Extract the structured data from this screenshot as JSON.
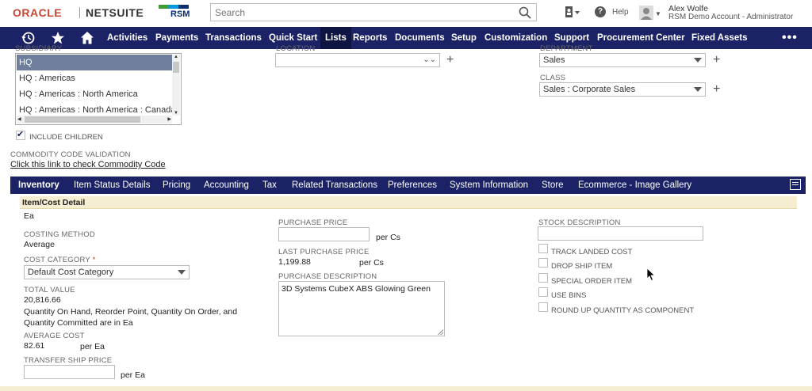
{
  "brand": {
    "oracle": "ORACLE",
    "netsuite": "NETSUITE",
    "partner": "RSM"
  },
  "search": {
    "placeholder": "Search"
  },
  "help": {
    "label": "Help"
  },
  "user": {
    "name": "Alex Wolfe",
    "role": "RSM Demo Account - Administrator"
  },
  "nav": {
    "items": [
      "Activities",
      "Payments",
      "Transactions",
      "Quick Start",
      "Lists",
      "Reports",
      "Documents",
      "Setup",
      "Customization",
      "Support",
      "Procurement Center",
      "Fixed Assets"
    ],
    "active": "Lists",
    "more": "•••"
  },
  "form": {
    "subsidiary": {
      "label": "SUBSIDIARY",
      "options": [
        "HQ",
        "HQ : Americas",
        "HQ : Americas : North America",
        "HQ : Americas : North America : Canada"
      ],
      "selected": "HQ"
    },
    "include_children": {
      "label": "INCLUDE CHILDREN",
      "checked": true
    },
    "commodity": {
      "label": "COMMODITY CODE VALIDATION",
      "link": "Click this link to check Commodity Code"
    },
    "location": {
      "label": "LOCATION",
      "value": ""
    },
    "department": {
      "label": "DEPARTMENT",
      "value": "Sales"
    },
    "class": {
      "label": "CLASS",
      "value": "Sales : Corporate Sales"
    }
  },
  "subtabs": {
    "items": [
      "Inventory",
      "Item Status Details",
      "Pricing",
      "Accounting",
      "Tax",
      "Related Transactions",
      "Preferences",
      "System Information",
      "Store",
      "Ecommerce - Image Gallery"
    ],
    "active": "Inventory"
  },
  "inventory": {
    "section_title": "Item/Cost Detail",
    "unit": "Ea",
    "costing_method": {
      "label": "COSTING METHOD",
      "value": "Average"
    },
    "cost_category": {
      "label": "COST CATEGORY",
      "required_mark": "*",
      "value": "Default Cost Category"
    },
    "total_value": {
      "label": "TOTAL VALUE",
      "value": "20,816.66"
    },
    "quantity_note": "Quantity On Hand, Reorder Point, Quantity On Order, and Quantity Committed are in Ea",
    "average_cost": {
      "label": "AVERAGE COST",
      "value": "82.61",
      "unit": "per Ea"
    },
    "transfer_ship_price": {
      "label": "TRANSFER SHIP PRICE",
      "value": "",
      "unit": "per Ea"
    },
    "purchase_price": {
      "label": "PURCHASE PRICE",
      "value": "",
      "unit": "per Cs"
    },
    "last_purchase_price": {
      "label": "LAST PURCHASE PRICE",
      "value": "1,199.88",
      "unit": "per Cs"
    },
    "purchase_description": {
      "label": "PURCHASE DESCRIPTION",
      "value": "3D Systems CubeX ABS Glowing Green"
    },
    "stock_description": {
      "label": "STOCK DESCRIPTION",
      "value": ""
    },
    "checkboxes": {
      "track_landed_cost": "TRACK LANDED COST",
      "drop_ship_item": "DROP SHIP ITEM",
      "special_order_item": "SPECIAL ORDER ITEM",
      "use_bins": "USE BINS",
      "round_up": "ROUND UP QUANTITY AS COMPONENT"
    }
  },
  "colors": {
    "nav_bg": "#1b2366",
    "accent_red": "#c74634",
    "section_bg": "#f6eed2",
    "selected_row": "#6e7e9c"
  }
}
